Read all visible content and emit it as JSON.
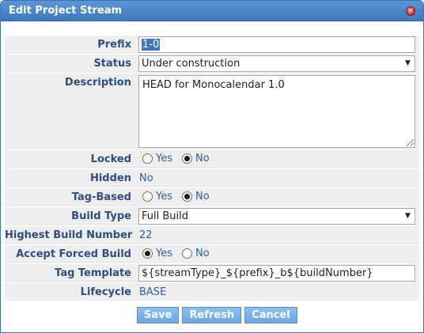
{
  "dialog": {
    "title": "Edit Project Stream",
    "close_glyph": "×"
  },
  "fields": {
    "prefix": {
      "label": "Prefix",
      "value": "1-0"
    },
    "status": {
      "label": "Status",
      "value": "Under construction"
    },
    "description": {
      "label": "Description",
      "value": "HEAD for Monocalendar 1.0"
    },
    "locked": {
      "label": "Locked",
      "yes": "Yes",
      "no": "No",
      "selected": "No"
    },
    "hidden": {
      "label": "Hidden",
      "value": "No"
    },
    "tag_based": {
      "label": "Tag-Based",
      "yes": "Yes",
      "no": "No",
      "selected": "No"
    },
    "build_type": {
      "label": "Build Type",
      "value": "Full Build"
    },
    "highest_build_number": {
      "label": "Highest Build Number",
      "value": "22"
    },
    "accept_forced_build": {
      "label": "Accept Forced Build",
      "yes": "Yes",
      "no": "No",
      "selected": "Yes"
    },
    "tag_template": {
      "label": "Tag Template",
      "value": "${streamType}_${prefix}_b${buildNumber}"
    },
    "lifecycle": {
      "label": "Lifecycle",
      "value": "BASE"
    }
  },
  "buttons": {
    "save": "Save",
    "refresh": "Refresh",
    "cancel": "Cancel"
  },
  "colors": {
    "titlebar": "#4a86c8",
    "label": "#2e4e7e",
    "button": "#7ab4ea"
  }
}
